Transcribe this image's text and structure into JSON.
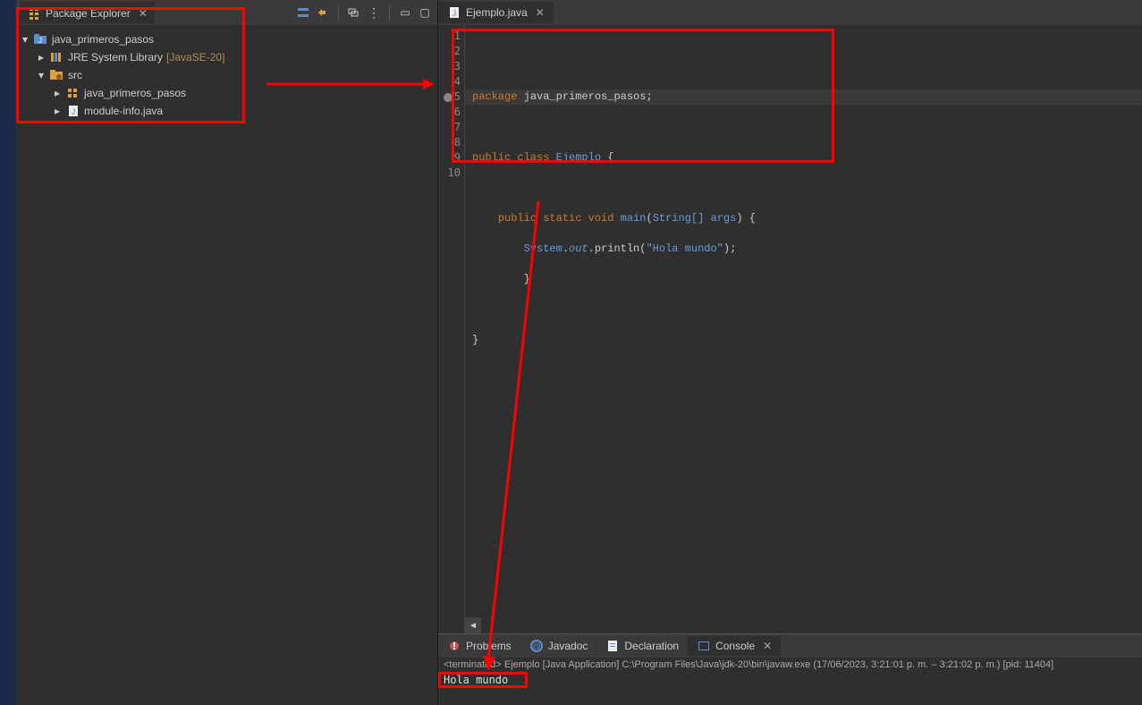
{
  "explorer": {
    "title": "Package Explorer",
    "project": "java_primeros_pasos",
    "jre_label": "JRE System Library",
    "jre_version": "[JavaSE-20]",
    "src_folder": "src",
    "package_name": "java_primeros_pasos",
    "module_info": "module-info.java"
  },
  "editor": {
    "tab_title": "Ejemplo.java",
    "line_numbers": [
      "1",
      "2",
      "3",
      "4",
      "5",
      "6",
      "7",
      "8",
      "9",
      "10"
    ],
    "code": {
      "l1_kw": "package",
      "l1_txt": " java_primeros_pasos;",
      "l3_kw": "public class",
      "l3_name": " Ejemplo",
      "l3_brace": " {",
      "l5_kw1": "public",
      "l5_kw2": " static",
      "l5_kw3": " void",
      "l5_fn": " main",
      "l5_p1": "(",
      "l5_type": "String",
      "l5_arr": "[]",
      "l5_arg": " args",
      "l5_p2": ") {",
      "l6_sys": "System",
      "l6_dot1": ".",
      "l6_out": "out",
      "l6_dot2": ".",
      "l6_pln": "println",
      "l6_p1": "(",
      "l6_str": "\"Hola mundo\"",
      "l6_p2": ");",
      "l7_brace": "}",
      "l9_brace": "}"
    }
  },
  "bottom": {
    "tab_problems": "Problems",
    "tab_javadoc": "Javadoc",
    "tab_declaration": "Declaration",
    "tab_console": "Console",
    "status": "<terminated> Ejemplo [Java Application] C:\\Program Files\\Java\\jdk-20\\bin\\javaw.exe  (17/06/2023, 3:21:01 p. m. – 3:21:02 p. m.) [pid: 11404]",
    "output": "Hola mundo"
  }
}
